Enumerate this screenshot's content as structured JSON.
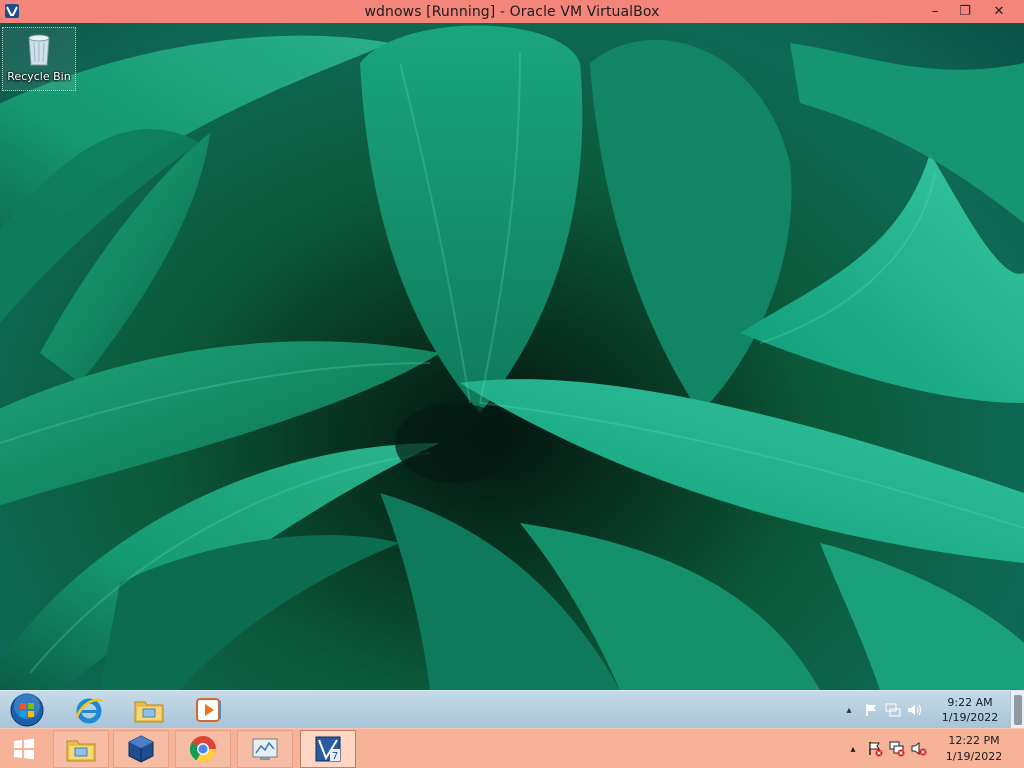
{
  "host_window": {
    "title": "wdnows [Running] - Oracle VM VirtualBox",
    "controls": {
      "minimize": "–",
      "restore": "❐",
      "close": "✕"
    },
    "accent_color": "#f4857a"
  },
  "desktop": {
    "icons": [
      {
        "label": "Recycle Bin",
        "icon": "recycle-bin-icon"
      }
    ]
  },
  "guest_taskbar": {
    "pinned": [
      "windows7-start-orb",
      "internet-explorer-icon",
      "file-explorer-icon",
      "media-player-icon"
    ],
    "tray": {
      "show_hidden": "▴",
      "icons": [
        "action-center-flag-icon",
        "network-icon",
        "volume-icon"
      ],
      "time": "9:22 AM",
      "date": "1/19/2022"
    }
  },
  "host_taskbar": {
    "apps": [
      "windows-start-icon",
      "file-explorer-icon",
      "virtualbox-icon",
      "chrome-icon",
      "system-app-icon",
      "virtualbox-vm-icon"
    ],
    "tray": {
      "show_hidden": "▴",
      "icons": [
        "action-center-flag-warning-icon",
        "network-warning-icon",
        "volume-muted-icon"
      ],
      "time": "12:22 PM",
      "date": "1/19/2022"
    },
    "color": "#f6b398"
  }
}
